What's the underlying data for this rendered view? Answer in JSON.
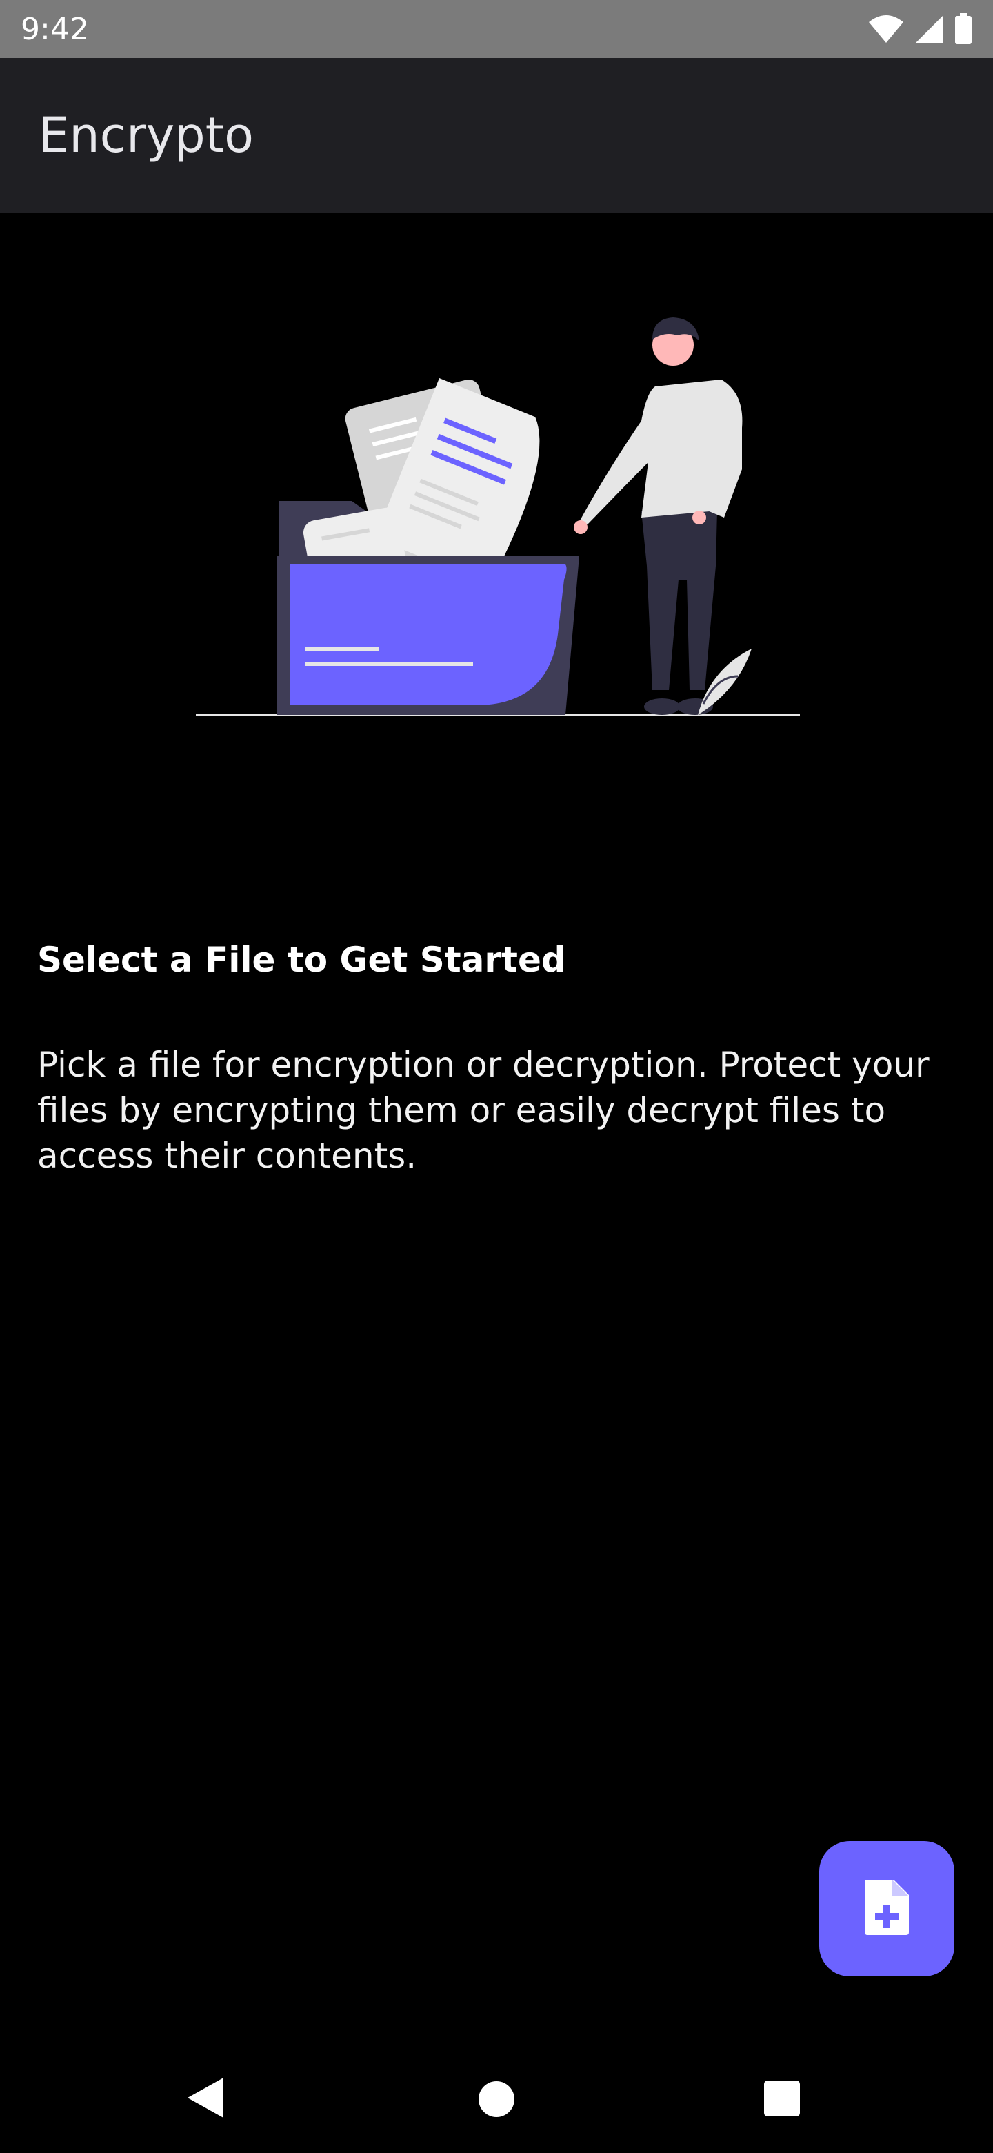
{
  "status_bar": {
    "time": "9:42",
    "icons": [
      "wifi-icon",
      "cellular-signal-icon",
      "battery-icon"
    ]
  },
  "app_bar": {
    "title": "Encrypto"
  },
  "illustration": {
    "icon": "person-with-file-folder-illustration"
  },
  "content": {
    "headline": "Select a File to Get Started",
    "description": "Pick a file for encryption or decryption. Protect your files by encrypting them or easily decrypt files to access their contents."
  },
  "fab": {
    "icon": "add-file-icon"
  },
  "nav_bar": {
    "buttons": [
      "back-icon",
      "home-icon",
      "recents-icon"
    ]
  },
  "colors": {
    "accent": "#6c63ff",
    "background": "#000000",
    "app_bar": "#1f1f23",
    "status_bar": "#7b7b7b"
  }
}
